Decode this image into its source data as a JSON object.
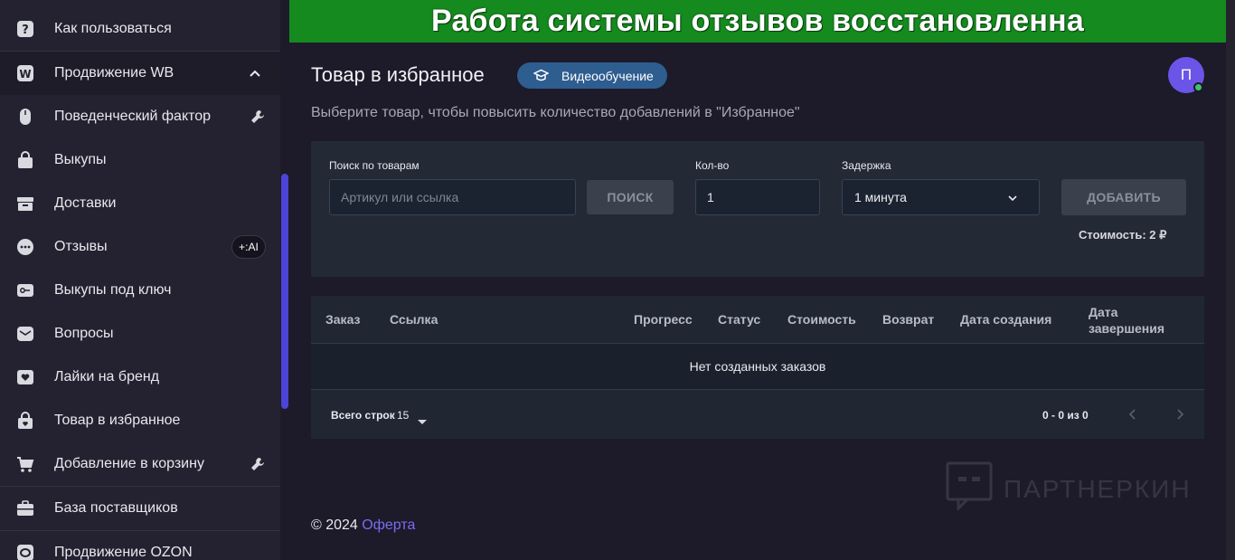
{
  "banner": {
    "text": "Работа системы отзывов восстановленна"
  },
  "sidebar": {
    "items": [
      {
        "label": "Как пользоваться",
        "icon": "question-icon"
      },
      {
        "label": "Продвижение WB",
        "icon": "wb-logo-icon"
      },
      {
        "label": "Поведенческий фактор",
        "icon": "mouse-icon"
      },
      {
        "label": "Выкупы",
        "icon": "bag-icon"
      },
      {
        "label": "Доставки",
        "icon": "box-icon"
      },
      {
        "label": "Отзывы",
        "icon": "chat-icon",
        "badge": "+:AI"
      },
      {
        "label": "Выкупы под ключ",
        "icon": "key-icon"
      },
      {
        "label": "Вопросы",
        "icon": "envelope-icon"
      },
      {
        "label": "Лайки на бренд",
        "icon": "heart-icon"
      },
      {
        "label": "Товар в избранное",
        "icon": "bag-heart-icon"
      },
      {
        "label": "Добавление в корзину",
        "icon": "cart-icon"
      },
      {
        "label": "База поставщиков",
        "icon": "briefcase-icon"
      },
      {
        "label": "Продвижение OZON",
        "icon": "ozon-logo-icon"
      }
    ]
  },
  "header": {
    "title": "Товар в избранное",
    "video_button": "Видеообучение",
    "avatar_letter": "П",
    "subtitle": "Выберите товар, чтобы повысить количество добавлений в \"Избранное\""
  },
  "form": {
    "search_label": "Поиск по товарам",
    "search_placeholder": "Артикул или ссылка",
    "search_button": "ПОИСК",
    "qty_label": "Кол-во",
    "qty_value": "1",
    "delay_label": "Задержка",
    "delay_value": "1 минута",
    "add_button": "ДОБАВИТЬ",
    "cost": "Стоимость: 2 ₽"
  },
  "table": {
    "headers": [
      "Заказ",
      "Ссылка",
      "Прогресс",
      "Статус",
      "Стоимость",
      "Возврат",
      "Дата создания",
      "Дата завершения"
    ],
    "empty_text": "Нет созданных заказов",
    "rows_label": "Всего строк",
    "rows_value": "15",
    "range": "0 - 0 из 0"
  },
  "watermark": {
    "text": "ПАРТНЕРКИН"
  },
  "footer": {
    "copyright": "© 2024",
    "link": "Оферта"
  },
  "colors": {
    "accent": "#6a55e8",
    "banner": "#158a1f",
    "badge_blue": "#2e5d8f"
  }
}
